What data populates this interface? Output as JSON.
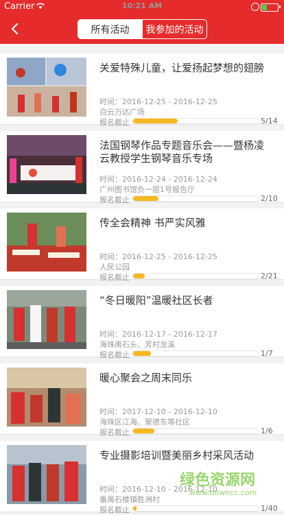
{
  "status_bar": {
    "carrier": "Carrier",
    "time": "10:21 AM"
  },
  "nav": {
    "tabs": [
      "所有活动",
      "我参加的活动"
    ]
  },
  "items": [
    {
      "title": "关爱特殊儿童，让爱扬起梦想的翅膀",
      "time": "时间：2016-12-25 - 2016-12-25",
      "place": "白云万达广场",
      "deadline": "报名截止",
      "count": "5/14",
      "progress": 0.357
    },
    {
      "title": "法国钢琴作品专题音乐会——暨杨凌云教授学生钢琴音乐专场",
      "time": "时间：2016-12-24 - 2016-12-24",
      "place": "广州图书馆负一层1号报告厅",
      "deadline": "报名截止",
      "count": "2/10",
      "progress": 0.2
    },
    {
      "title": "传全会精神  书严实风雅",
      "time": "时间：2016-12-25 - 2016-12-25",
      "place": "人民公园",
      "deadline": "报名截止",
      "count": "2/21",
      "progress": 0.095
    },
    {
      "title": "“冬日暖阳”温暖社区长者",
      "time": "时间：2016-12-17 - 2016-12-17",
      "place": "海珠南石头、芳村龙溪",
      "deadline": "报名截止",
      "count": "1/7",
      "progress": 0.143
    },
    {
      "title": "暖心聚会之周末同乐",
      "time": "时间：2017-12-10 - 2016-12-10",
      "place": "海珠区江海、聚德东等社区",
      "deadline": "报名截止",
      "count": "1/6",
      "progress": 0.167
    },
    {
      "title": "专业摄影培训暨美丽乡村采风活动",
      "time": "时间：2016-12-10 - 2016-12-10",
      "place": "番禺石楼镇胜洲村",
      "deadline": "报名截止",
      "count": "1/40",
      "progress": 0.025
    }
  ],
  "watermark": {
    "main": "绿色资源网",
    "sub": "www.downcc.com"
  },
  "colors": {
    "brand_red": "#e52b2b",
    "progress_fill": "#f6b820"
  }
}
